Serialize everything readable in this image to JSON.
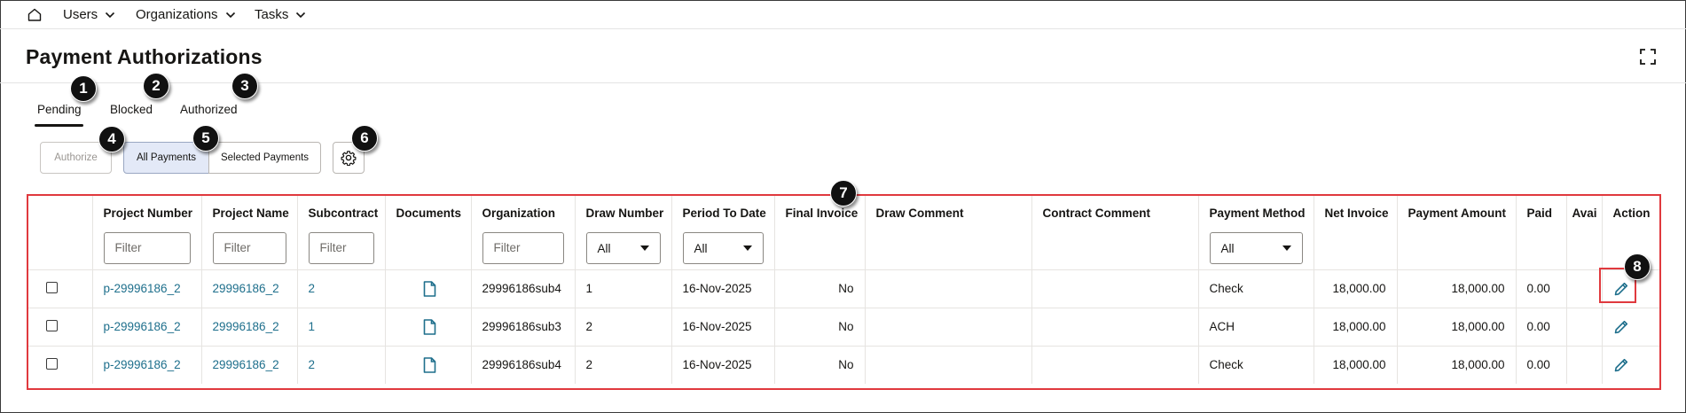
{
  "nav": {
    "home_icon": "home-icon",
    "items": [
      {
        "label": "Users"
      },
      {
        "label": "Organizations"
      },
      {
        "label": "Tasks"
      }
    ]
  },
  "header": {
    "title": "Payment Authorizations",
    "expand_icon": "expand-icon"
  },
  "tabs": [
    {
      "label": "Pending",
      "selected": true
    },
    {
      "label": "Blocked"
    },
    {
      "label": "Authorized"
    }
  ],
  "toolbar": {
    "authorize_label": "Authorize",
    "all_payments_label": "All Payments",
    "selected_payments_label": "Selected Payments",
    "settings_icon": "gear-icon"
  },
  "table": {
    "columns": [
      "",
      "Project Number",
      "Project Name",
      "Subcontract",
      "Documents",
      "Organization",
      "Draw Number",
      "Period To Date",
      "Final Invoice",
      "Draw Comment",
      "Contract Comment",
      "Payment Method",
      "Net Invoice",
      "Payment Amount",
      "Paid",
      "Avai",
      "Action"
    ],
    "filter_placeholder": "Filter",
    "select_value": "All",
    "rows": [
      {
        "project_number": "p-29996186_2",
        "project_name": "29996186_2",
        "subcontract": "2",
        "organization": "29996186sub4",
        "draw_number": "1",
        "period_to_date": "16-Nov-2025",
        "final_invoice": "No",
        "draw_comment": "",
        "contract_comment": "",
        "payment_method": "Check",
        "net_invoice": "18,000.00",
        "payment_amount": "18,000.00",
        "paid": "0.00"
      },
      {
        "project_number": "p-29996186_2",
        "project_name": "29996186_2",
        "subcontract": "1",
        "organization": "29996186sub3",
        "draw_number": "2",
        "period_to_date": "16-Nov-2025",
        "final_invoice": "No",
        "draw_comment": "",
        "contract_comment": "",
        "payment_method": "ACH",
        "net_invoice": "18,000.00",
        "payment_amount": "18,000.00",
        "paid": "0.00"
      },
      {
        "project_number": "p-29996186_2",
        "project_name": "29996186_2",
        "subcontract": "2",
        "organization": "29996186sub4",
        "draw_number": "2",
        "period_to_date": "16-Nov-2025",
        "final_invoice": "No",
        "draw_comment": "",
        "contract_comment": "",
        "payment_method": "Check",
        "net_invoice": "18,000.00",
        "payment_amount": "18,000.00",
        "paid": "0.00"
      }
    ]
  },
  "callouts": [
    "1",
    "2",
    "3",
    "4",
    "5",
    "6",
    "7",
    "8"
  ],
  "colors": {
    "link": "#1e6f8c",
    "highlight": "#e0393e",
    "selected_segment": "#e3e9f7"
  }
}
